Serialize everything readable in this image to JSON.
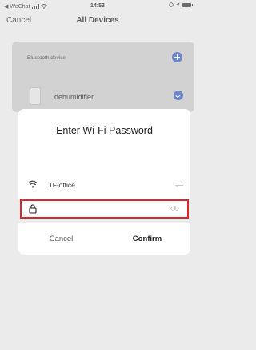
{
  "status_bar": {
    "carrier": "◀ WeChat",
    "time": "14:53",
    "icons": [
      "signal-icon",
      "wifi-icon",
      "alarm-icon",
      "location-icon",
      "battery-icon"
    ]
  },
  "nav": {
    "cancel_label": "Cancel",
    "title": "All Devices"
  },
  "device_card": {
    "section_label": "Bluetooth device",
    "add_icon": "plus-circle-icon",
    "device_name": "dehumidifier",
    "selected": true
  },
  "wifi_dialog": {
    "title": "Enter Wi-Fi Password",
    "network_name": "1F-office",
    "password_value": "",
    "cancel_label": "Cancel",
    "confirm_label": "Confirm",
    "highlight_color": "#e0242e"
  },
  "colors": {
    "accent": "#6b86c9",
    "backdrop": "#ebebeb"
  }
}
